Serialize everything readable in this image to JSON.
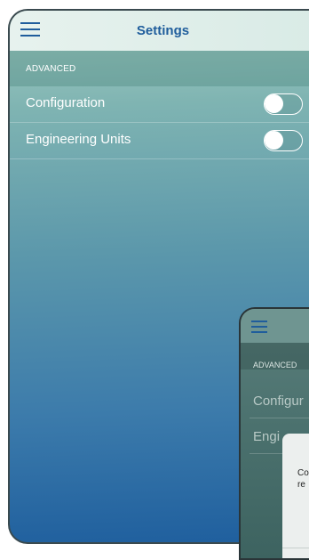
{
  "header": {
    "title": "Settings"
  },
  "section": {
    "label": "ADVANCED"
  },
  "settings": [
    {
      "label": "Configuration",
      "enabled": false
    },
    {
      "label": "Engineering Units",
      "enabled": false
    }
  ],
  "overlay_phone": {
    "section_label": "ADVANCED",
    "row1": "Configur",
    "row2": "Engi",
    "dialog_line1": "Co",
    "dialog_line2": "re"
  },
  "colors": {
    "accent": "#1f5d9c",
    "header_bg": "#e3f0ec",
    "gradient_top": "#a9cfc5",
    "gradient_bottom": "#1f5f9e"
  }
}
